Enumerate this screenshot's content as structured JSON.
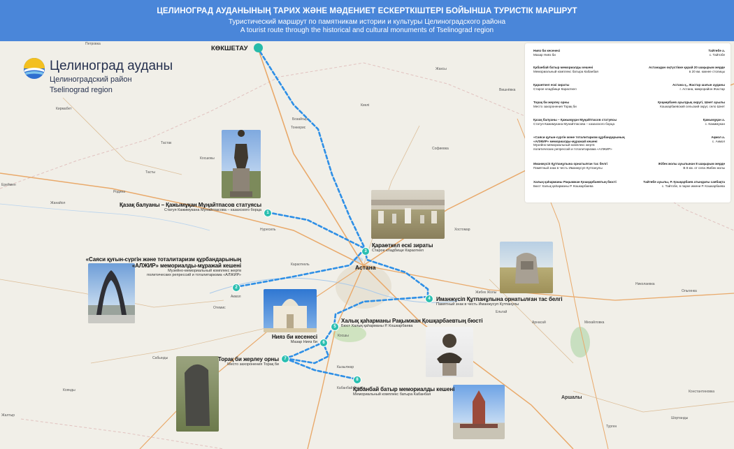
{
  "header": {
    "title_kz": "ЦЕЛИНОГРАД АУДАНЫНЫҢ ТАРИХ ЖӘНЕ МӘДЕНИЕТ ЕСКЕРТКІШТЕРІ БОЙЫНША ТУРИСТІК МАРШРУТ",
    "title_ru": "Туристический маршрут по памятникам истории и культуры Целиноградского района",
    "title_en": "A tourist route through the historical and cultural monuments of  Tselinograd region"
  },
  "region": {
    "name_kz": "Целиноград ауданы",
    "name_ru": "Целиноградский район",
    "name_en": "Tselinograd region"
  },
  "start_city": "КӨКШЕТАУ",
  "capital": "Астана",
  "places": [
    {
      "name": "Петровка"
    },
    {
      "name": "Кирмабет"
    },
    {
      "name": "Тастак"
    },
    {
      "name": "Тасты"
    },
    {
      "name": "Родина"
    },
    {
      "name": "Жанайол"
    },
    {
      "name": "Ереймен"
    },
    {
      "name": "Бозайгыр"
    },
    {
      "name": "Тонкерис"
    },
    {
      "name": "Косшокы"
    },
    {
      "name": "Киелі"
    },
    {
      "name": "Софиевка"
    },
    {
      "name": "Нуресиль"
    },
    {
      "name": "Караоткель"
    },
    {
      "name": "Косшы"
    },
    {
      "name": "Акмол"
    },
    {
      "name": "Отемис"
    },
    {
      "name": "Кызылжар"
    },
    {
      "name": "Кабанбай батыра"
    },
    {
      "name": "Хостомар"
    },
    {
      "name": "Жибек Жолы"
    },
    {
      "name": "Ельтай"
    },
    {
      "name": "Аршалы"
    },
    {
      "name": "Константиновка"
    },
    {
      "name": "Жалтыр"
    },
    {
      "name": "Сабынды"
    },
    {
      "name": "Коянды"
    },
    {
      "name": "Софиевка"
    },
    {
      "name": "Арнасай"
    },
    {
      "name": "Михайловка"
    },
    {
      "name": "Николаевка"
    },
    {
      "name": "Ольгинка"
    },
    {
      "name": "Турген"
    },
    {
      "name": "Шортанды"
    },
    {
      "name": "Жаксы"
    },
    {
      "name": "Вишнёвка"
    }
  ],
  "stops": [
    {
      "num": "1",
      "kz": "Қазақ балуаны – Қажымұқан Мұңайтпасов статуясы",
      "ru": "Статуя Кажимукана Мунайтпасова – казахского борца"
    },
    {
      "num": "2",
      "kz": "«Саяси қуғын-сүргін және тоталитаризм құрбандарының «АЛЖИР» мемориалды-мұражай кешені",
      "kz1": "«Саяси қуғын-сүргін және тоталитаризм құрбандарының",
      "kz2": "«АЛЖИР» мемориалды-мұражай кешені",
      "ru1": "Музейно-мемориальный комплекс жертв",
      "ru2": "политических репрессий и тоталитаризма «АЛЖИР»"
    },
    {
      "num": "3",
      "kz": "Қараөткел ескі зираты",
      "ru": "Старое кладбище Караоткел"
    },
    {
      "num": "4",
      "kz": "Иманжүсіп Құтпанұлына орнатылған тас белгі",
      "ru": "Памятный знак в честь Иманжусуп Кутпанулы"
    },
    {
      "num": "5",
      "kz": "Халық қаһарманы Рақымжан  Қошқарбаевтың бюсті",
      "ru": "Бюст Халық қаһарманы Р. Кошкарбаева"
    },
    {
      "num": "6",
      "kz": "Нияз би кесенесі",
      "ru": "Мазар Нияз би"
    },
    {
      "num": "7",
      "kz": "Торақ би жерлеу орны",
      "ru": "Место захоронения Торақ би"
    },
    {
      "num": "8",
      "kz": "Қабанбай батыр мемориалды кешені",
      "ru": "Мемориальный комплекс батыра Кабанбая"
    }
  ],
  "legend": [
    {
      "kz": "Нияз би кесенесі",
      "ru": "Мазар Нияз би",
      "loc_kz": "Тайтөбе а.",
      "loc_ru": "с. Тайтобе"
    },
    {
      "kz": "Қабанбай батыр мемориалды кешені",
      "ru": "Мемориальный комплекс батыра Кабанбая",
      "loc_kz": "Астанадан оңтүстікке қарай 20 шақырым жерде",
      "loc_ru": "в 20 км. южнее столицы"
    },
    {
      "kz": "Қараөткел ескі зираты",
      "ru": "Старое кладбище Караоткел",
      "loc_kz": "Астана қ., Жастар шағын ауданы",
      "loc_ru": "г. Астана, микрорайон Жастар"
    },
    {
      "kz": "Торақ би жерлеу орны",
      "ru": "Место захоронения Торақ би",
      "loc_kz": "Қоқаөрбаев ауылдық округі, Шнет ауылы",
      "loc_ru": "Кошкарбаевский сельский округ, село Шнет"
    },
    {
      "kz": "Қазақ балуаны – Қажымұқан Мұңайтпасов статуясы",
      "ru": "Статуя Кажимукана Мунайтпасова – казахского борца",
      "loc_kz": "Қажымұқан а.",
      "loc_ru": "с. Кажимукан"
    },
    {
      "kz1": "«Саяси қуғын-сүргін және тоталитаризм құрбандарының",
      "kz2": "«АЛЖИР» мемориалды-мұражай кешені",
      "ru1": "Музейно-мемориальный комплекс жертв",
      "ru2": "политических репрессий и тоталитаризма «АЛЖИР»",
      "loc_kz": "Ақмол а.",
      "loc_ru": "с. Акмол"
    },
    {
      "kz": "Иманжүсіп Құтпанұлына орнатылған тас белгі",
      "ru": "Памятный знак в честь Иманжусуп Кутпанулы",
      "loc_kz": "Жібек жолы ауылынан 8 шақырым жерде",
      "loc_ru": "В 8 км. от села Жибек жолы"
    },
    {
      "kz": "Халық қаһарманы Рақымжан Қошқарбаевтың бюсті",
      "ru": "Бюст Халық қаһарманы Р. Кошкарбаева",
      "loc_kz": "Тайтөбе ауылы, Р. Қошқарбаев атындағы саябақта",
      "loc_ru": "с. Тайтобе, в парке имени Р. Кошкарбаева"
    }
  ],
  "colors": {
    "header": "#4a86d9",
    "route": "#2e8fe6",
    "marker": "#2bbfb0",
    "map_bg": "#f1efe8",
    "road": "#e9a96a"
  }
}
